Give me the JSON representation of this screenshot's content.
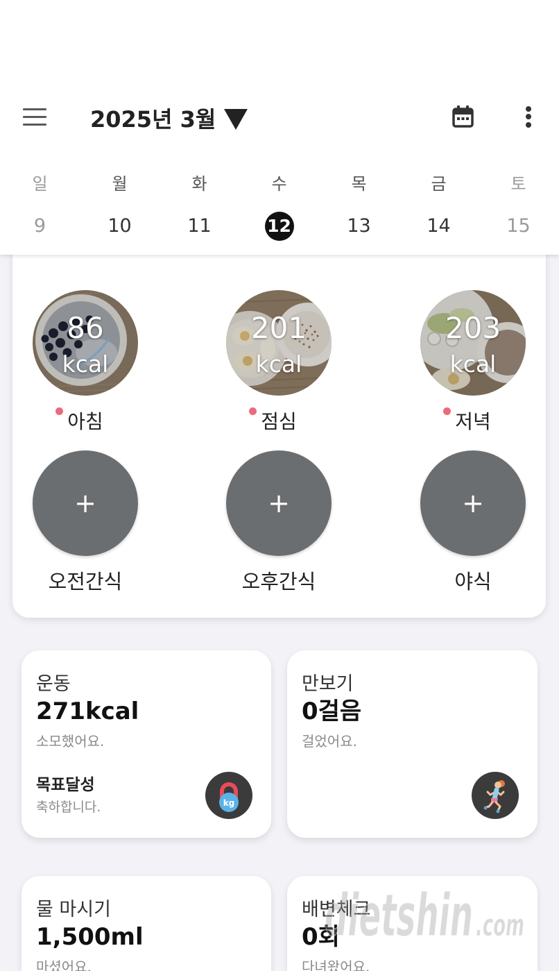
{
  "header": {
    "menu_icon": "hamburger-menu-icon",
    "title": "2025년 3월",
    "dropdown_icon": "caret-down-icon",
    "calendar_icon": "calendar-icon",
    "more_icon": "more-vertical-icon"
  },
  "week": {
    "days": [
      {
        "name": "일",
        "date": "9",
        "weekend": true
      },
      {
        "name": "월",
        "date": "10",
        "weekend": false
      },
      {
        "name": "화",
        "date": "11",
        "weekend": false
      },
      {
        "name": "수",
        "date": "12",
        "weekend": false
      },
      {
        "name": "목",
        "date": "13",
        "weekend": false
      },
      {
        "name": "금",
        "date": "14",
        "weekend": false
      },
      {
        "name": "토",
        "date": "15",
        "weekend": true
      }
    ],
    "selected_index": 3
  },
  "meals": {
    "logged": [
      {
        "label": "아침",
        "kcal": "86",
        "unit": "kcal"
      },
      {
        "label": "점심",
        "kcal": "201",
        "unit": "kcal"
      },
      {
        "label": "저녁",
        "kcal": "203",
        "unit": "kcal"
      }
    ],
    "add_symbol": "+",
    "add": [
      {
        "label": "오전간식"
      },
      {
        "label": "오후간식"
      },
      {
        "label": "야식"
      }
    ]
  },
  "cards": {
    "exercise": {
      "title": "운동",
      "value": "271kcal",
      "caption": "소모했어요.",
      "goal_title": "목표달성",
      "goal_caption": "축하합니다.",
      "icon": "kettlebell-icon",
      "icon_text": "kg"
    },
    "steps": {
      "title": "만보기",
      "value": "0걸음",
      "caption": "걸었어요.",
      "icon": "runner-icon"
    },
    "water": {
      "title": "물 마시기",
      "value": "1,500ml",
      "caption": "마셨어요."
    },
    "bowel": {
      "title": "배변체크",
      "value": "0회",
      "caption": "다녀왔어요."
    }
  },
  "watermark": {
    "main": "dietshin",
    "suffix": ".com"
  },
  "colors": {
    "page_background": "#f2f2f7",
    "card_background": "#ffffff",
    "selected_date": "#111111",
    "add_button": "#6b6e70",
    "unrecorded_dot": "#ec6a7c",
    "icon_badge": "#3b3b3b"
  }
}
